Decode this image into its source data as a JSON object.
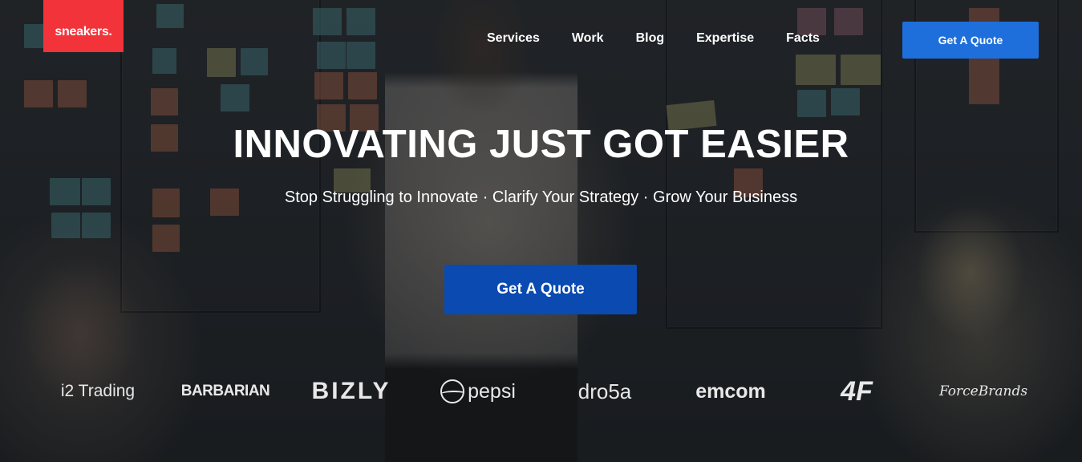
{
  "header": {
    "logo_text": "sneakers.",
    "nav": [
      "Services",
      "Work",
      "Blog",
      "Expertise",
      "Facts"
    ],
    "cta_label": "Get A Quote"
  },
  "hero": {
    "headline": "INNOVATING JUST GOT EASIER",
    "subline": "Stop Struggling to Innovate · Clarify Your Strategy · Grow Your Business",
    "cta_label": "Get A Quote"
  },
  "brands": {
    "i2": "i2 Trading",
    "barbarian": "BARBARIAN",
    "bizly": "BIZLY",
    "pepsi": "pepsi",
    "dro5a": "dro5a",
    "emcom": "emcom",
    "mark": "4F",
    "forcebrands": "ForceBrands"
  },
  "colors": {
    "logo_bg": "#f2333a",
    "top_button": "#1e6fdc",
    "main_button": "#0a4ab1"
  }
}
